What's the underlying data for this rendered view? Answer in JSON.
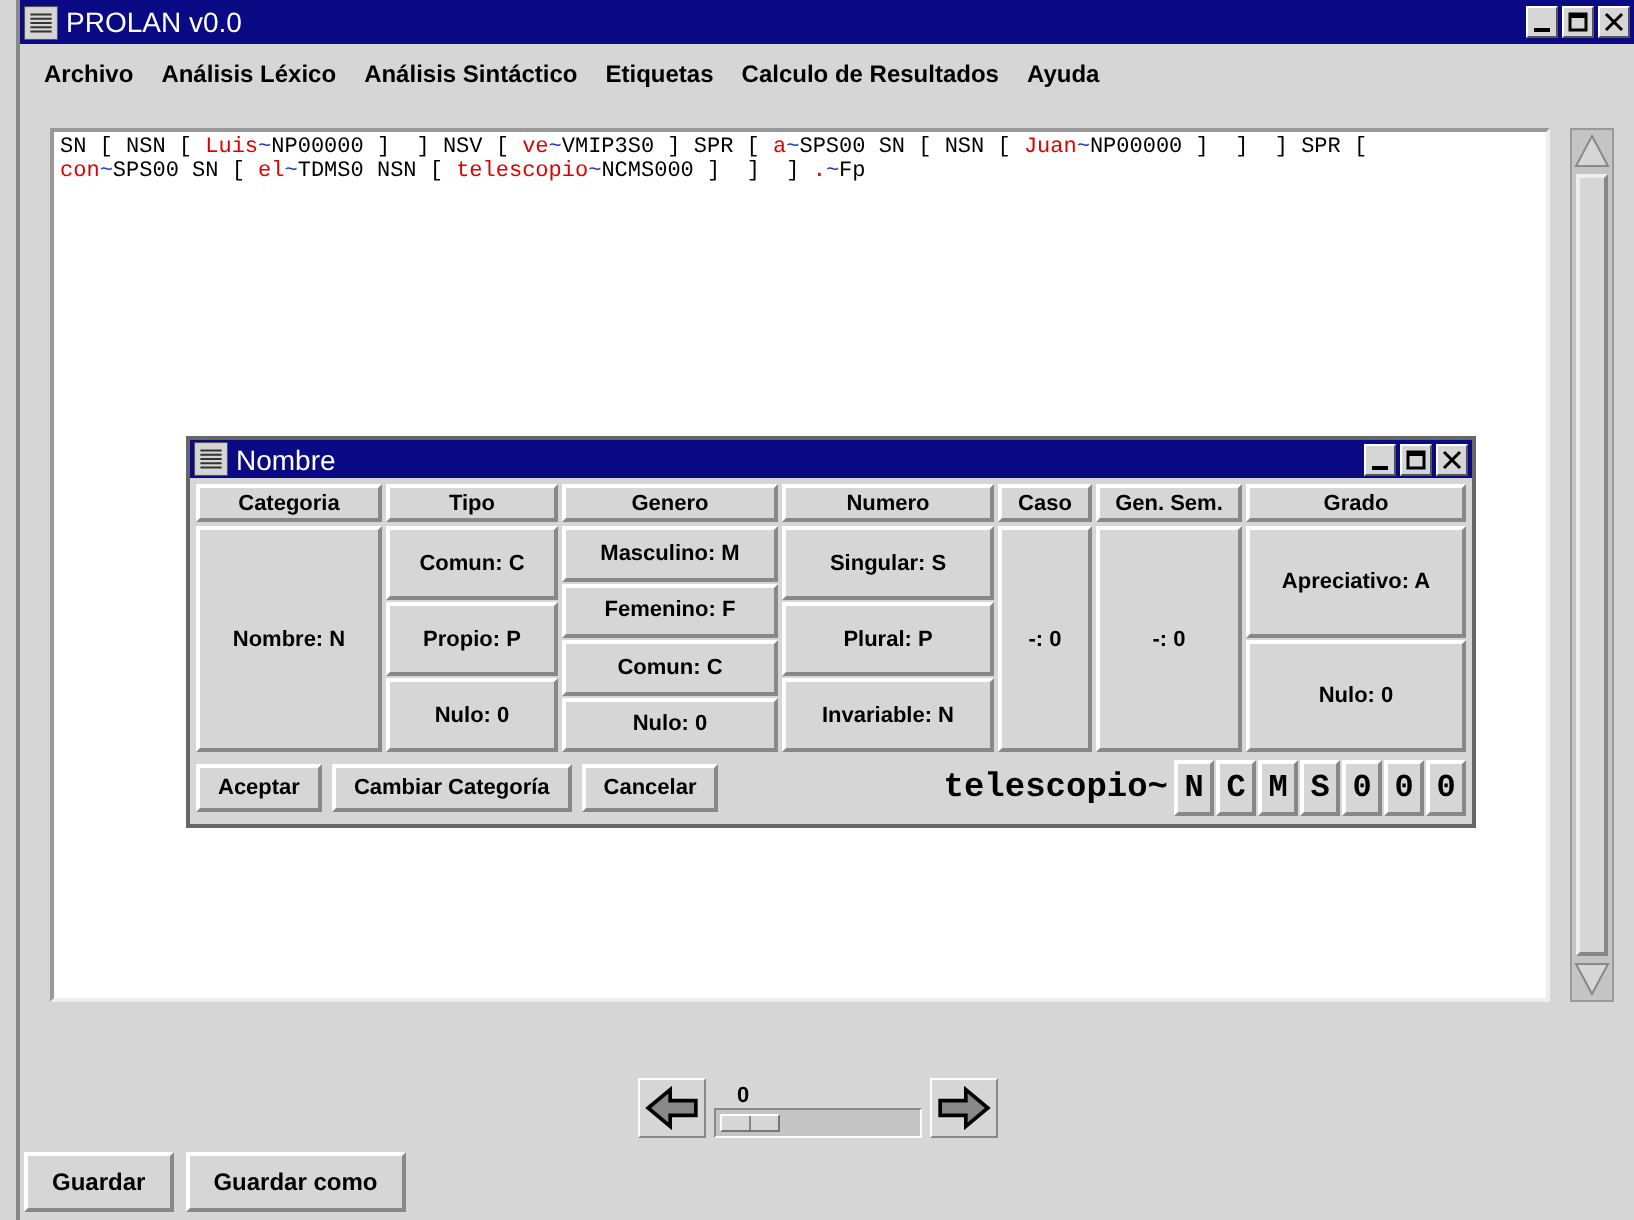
{
  "window": {
    "title": "PROLAN v0.0"
  },
  "menu": [
    "Archivo",
    "Análisis Léxico",
    "Análisis Sintáctico",
    "Etiquetas",
    "Calculo de Resultados",
    "Ayuda"
  ],
  "text_lines": [
    [
      {
        "text": "SN [ NSN [ ",
        "kind": "tag"
      },
      {
        "text": "Luis",
        "kind": "word"
      },
      {
        "text": "~",
        "kind": "sep"
      },
      {
        "text": "NP00000 ]  ] NSV [ ",
        "kind": "tag"
      },
      {
        "text": "ve",
        "kind": "word"
      },
      {
        "text": "~",
        "kind": "sep"
      },
      {
        "text": "VMIP3S0 ] SPR [ ",
        "kind": "tag"
      },
      {
        "text": "a",
        "kind": "word"
      },
      {
        "text": "~",
        "kind": "sep"
      },
      {
        "text": "SPS00 SN [ NSN [ ",
        "kind": "tag"
      },
      {
        "text": "Juan",
        "kind": "word"
      },
      {
        "text": "~",
        "kind": "sep"
      },
      {
        "text": "NP00000 ]  ]  ] SPR [",
        "kind": "tag"
      }
    ],
    [
      {
        "text": "con",
        "kind": "word"
      },
      {
        "text": "~",
        "kind": "sep"
      },
      {
        "text": "SPS00 SN [ ",
        "kind": "tag"
      },
      {
        "text": "el",
        "kind": "word"
      },
      {
        "text": "~",
        "kind": "sep"
      },
      {
        "text": "TDMS0 NSN [ ",
        "kind": "tag"
      },
      {
        "text": "telescopio",
        "kind": "word"
      },
      {
        "text": "~",
        "kind": "sep"
      },
      {
        "text": "NCMS000 ]  ]  ] ",
        "kind": "tag"
      },
      {
        "text": ".",
        "kind": "word"
      },
      {
        "text": "~",
        "kind": "sep"
      },
      {
        "text": "Fp",
        "kind": "tag"
      }
    ]
  ],
  "dialog": {
    "title": "Nombre",
    "columns": [
      {
        "header": "Categoria",
        "options": [
          "Nombre: N"
        ]
      },
      {
        "header": "Tipo",
        "options": [
          "Comun: C",
          "Propio: P",
          "Nulo: 0"
        ]
      },
      {
        "header": "Genero",
        "options": [
          "Masculino: M",
          "Femenino: F",
          "Comun: C",
          "Nulo: 0"
        ]
      },
      {
        "header": "Numero",
        "options": [
          "Singular: S",
          "Plural: P",
          "Invariable: N"
        ]
      },
      {
        "header": "Caso",
        "options": [
          "-: 0"
        ]
      },
      {
        "header": "Gen. Sem.",
        "options": [
          "-: 0"
        ]
      },
      {
        "header": "Grado",
        "options": [
          "Apreciativo: A",
          "Nulo: 0"
        ]
      }
    ],
    "buttons": [
      "Aceptar",
      "Cambiar Categoría",
      "Cancelar"
    ],
    "word": "telescopio~",
    "code": [
      "N",
      "C",
      "M",
      "S",
      "0",
      "0",
      "0"
    ]
  },
  "slider": {
    "reading": "0"
  },
  "buttons": [
    "Guardar",
    "Guardar como"
  ]
}
